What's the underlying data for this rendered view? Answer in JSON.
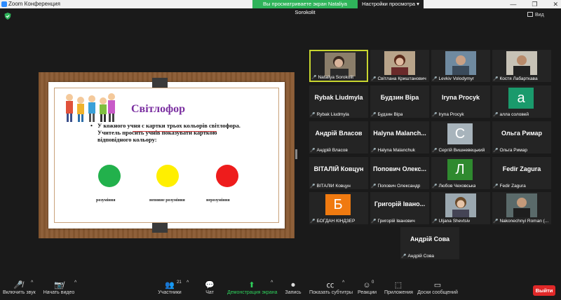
{
  "window": {
    "title": "Zoom Конференция",
    "share_banner": "Вы просматриваете экран Nataliya Sorokolit",
    "view_settings": "Настройки просмотра",
    "controls": [
      "—",
      "❐",
      "✕"
    ],
    "view_label": "Вид"
  },
  "slide": {
    "title": "Світлофор",
    "text": "У кожного учня с картки трьох кольорів світлофора. Учитель просить учнів показувати карткою відповідного кольору:",
    "labels": [
      "розуміння",
      "неповне розуміння",
      "нерозуміння"
    ]
  },
  "participants": [
    {
      "label": "Nataliya Sorokolit",
      "name_display": "",
      "kind": "video"
    },
    {
      "label": "Світлана Криштанович",
      "name_display": "",
      "kind": "video"
    },
    {
      "label": "Levkiv Volodymyr",
      "name_display": "",
      "kind": "video"
    },
    {
      "label": "Костя Лабарткава",
      "name_display": "",
      "kind": "video"
    },
    {
      "label": "Rybak Liudmyla",
      "name_display": "Rybak Liudmyla",
      "kind": "name"
    },
    {
      "label": "Будзин Віра",
      "name_display": "Будзин Віра",
      "kind": "name"
    },
    {
      "label": "Iryna Procyk",
      "name_display": "Iryna Procyk",
      "kind": "name"
    },
    {
      "label": "алла соловей",
      "name_display": "",
      "kind": "avatar",
      "letter": "а",
      "color": "#1a9a6c"
    },
    {
      "label": "Андрій Власов",
      "name_display": "Андрій Власов",
      "kind": "name"
    },
    {
      "label": "Halyna Malanchuk",
      "name_display": "Halyna  Malanch...",
      "kind": "name"
    },
    {
      "label": "Сергій Вишневецький",
      "name_display": "",
      "kind": "avatar",
      "letter": "С",
      "color": "#a8b4bc"
    },
    {
      "label": "Ольга Римар",
      "name_display": "Ольга Римар",
      "kind": "name"
    },
    {
      "label": "ВІТАЛІЙ Ковцун",
      "name_display": "ВІТАЛІЙ Ковцун",
      "kind": "name"
    },
    {
      "label": "Попович Олександр",
      "name_display": "Попович Олекс...",
      "kind": "name"
    },
    {
      "label": "Любов Чеховська",
      "name_display": "",
      "kind": "avatar",
      "letter": "Л",
      "color": "#2f8a2f"
    },
    {
      "label": "Fedir Zagura",
      "name_display": "Fedir Zagura",
      "kind": "name"
    },
    {
      "label": "БОГДАН КІНДЗЕР",
      "name_display": "",
      "kind": "avatar",
      "letter": "Б",
      "color": "#f07a10"
    },
    {
      "label": "Григорій Іванович",
      "name_display": "Григорій Івано...",
      "kind": "name"
    },
    {
      "label": "Uljana Shevtsiv",
      "name_display": "",
      "kind": "video"
    },
    {
      "label": "Nakonechnyi Roman (...",
      "name_display": "",
      "kind": "video"
    },
    {
      "label": "Андрій Сова",
      "name_display": "Андрій Сова",
      "kind": "name"
    }
  ],
  "toolbar": {
    "mute": "Включить звук",
    "video": "Начать видео",
    "participants": "Участники",
    "participants_count": "21",
    "chat": "Чат",
    "share": "Демонстрация экрана",
    "record": "Запись",
    "captions": "Показать субтитры",
    "reactions": "Реакции",
    "reactions_count": "0",
    "apps": "Приложения",
    "board": "Доски сообщений",
    "end": "Выйти"
  }
}
